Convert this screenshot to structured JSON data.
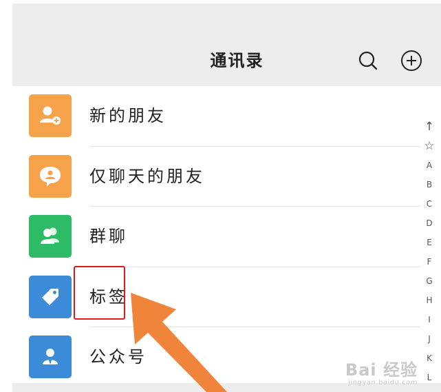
{
  "header": {
    "title": "通讯录",
    "search_icon": "search-icon",
    "add_icon": "add-circle-icon"
  },
  "contacts": {
    "items": [
      {
        "label": "新的朋友",
        "icon": "add-friend-icon",
        "color": "#F5A24B"
      },
      {
        "label": "仅聊天的朋友",
        "icon": "chat-bubble-icon",
        "color": "#F5A24B"
      },
      {
        "label": "群聊",
        "icon": "group-icon",
        "color": "#2DBB65"
      },
      {
        "label": "标签",
        "icon": "tag-icon",
        "color": "#3B8BD8"
      },
      {
        "label": "公众号",
        "icon": "official-account-icon",
        "color": "#3B8BD8"
      }
    ]
  },
  "index_bar": {
    "items": [
      "↑",
      "☆",
      "A",
      "B",
      "C",
      "D",
      "E",
      "F",
      "G",
      "H",
      "I",
      "J",
      "K",
      "L"
    ]
  },
  "annotation": {
    "highlight_color": "#E21818",
    "arrow_color": "#F0843A"
  },
  "watermark": {
    "main": "Bai 经验",
    "sub": "jingyan.baidu.com"
  }
}
